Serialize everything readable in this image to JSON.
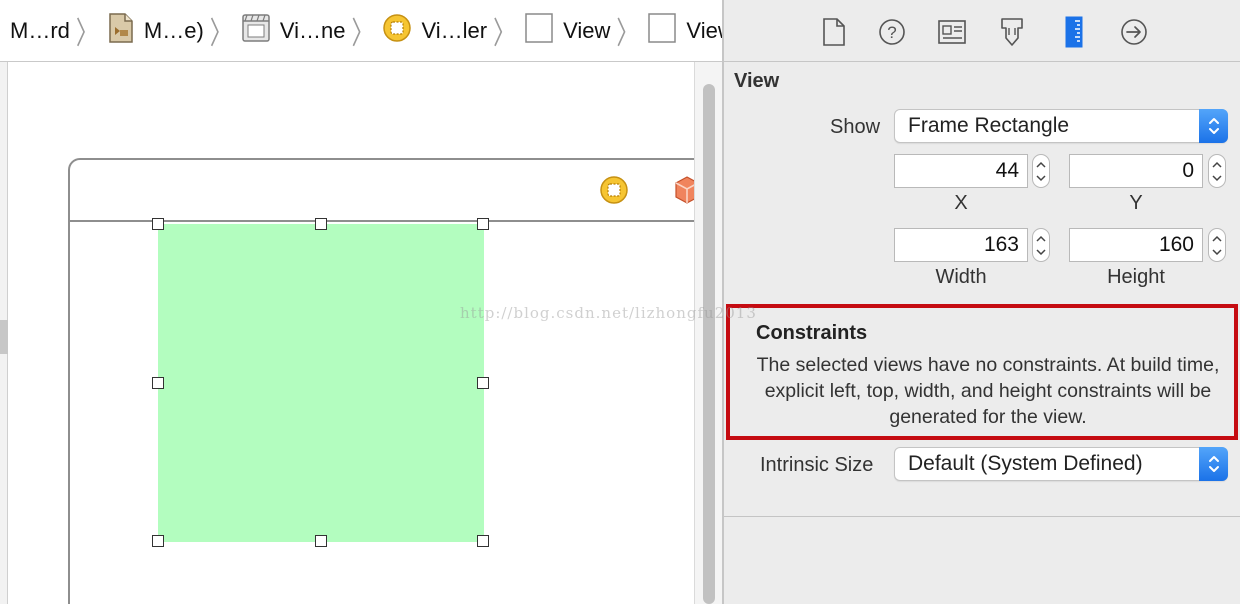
{
  "breadcrumb": [
    {
      "label": "M…rd",
      "icon": "storyboard-file-icon"
    },
    {
      "label": "M…e)",
      "icon": "storyboard-doc-icon"
    },
    {
      "label": "Vi…ne",
      "icon": "scene-icon"
    },
    {
      "label": "Vi…ler",
      "icon": "view-controller-icon"
    },
    {
      "label": "View",
      "icon": "view-icon"
    },
    {
      "label": "View",
      "icon": "view-icon"
    }
  ],
  "inspector": {
    "tabs": [
      "file-inspector-icon",
      "quick-help-icon",
      "identity-inspector-icon",
      "attributes-inspector-icon",
      "size-inspector-icon",
      "connections-inspector-icon"
    ],
    "section_title": "View",
    "show_label": "Show",
    "show_value": "Frame Rectangle",
    "x_value": "44",
    "x_label": "X",
    "y_value": "0",
    "y_label": "Y",
    "width_value": "163",
    "width_label": "Width",
    "height_value": "160",
    "height_label": "Height",
    "constraints_title": "Constraints",
    "constraints_text": "The selected views have no constraints. At build time, explicit left, top, width, and height constraints will be generated for the view.",
    "intrinsic_label": "Intrinsic Size",
    "intrinsic_value": "Default (System Defined)"
  },
  "canvas": {
    "view_color": "#b3fdbf",
    "watermark": "http://blog.csdn.net/lizhongfu2013"
  },
  "colors": {
    "highlight_border": "#c50b11",
    "popup_accent": "#1b72e8",
    "active_tab": "#1b72e8"
  }
}
